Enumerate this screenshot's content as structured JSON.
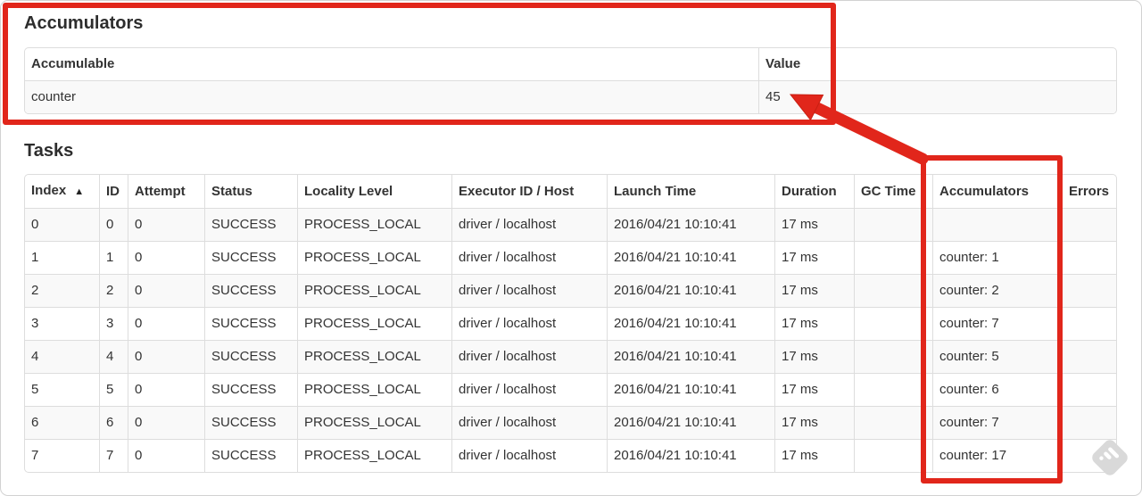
{
  "headings": {
    "accumulators": "Accumulators",
    "tasks": "Tasks"
  },
  "tables": {
    "accumulators": {
      "headers": [
        "Accumulable",
        "Value"
      ],
      "sorted_column": -1,
      "sort_icon": "",
      "rows": [
        [
          "counter",
          "45"
        ]
      ]
    },
    "tasks": {
      "headers": [
        "Index",
        "ID",
        "Attempt",
        "Status",
        "Locality Level",
        "Executor ID / Host",
        "Launch Time",
        "Duration",
        "GC Time",
        "Accumulators",
        "Errors"
      ],
      "sorted_column": 0,
      "sort_icon": "▲",
      "rows": [
        [
          "0",
          "0",
          "0",
          "SUCCESS",
          "PROCESS_LOCAL",
          "driver / localhost",
          "2016/04/21 10:10:41",
          "17 ms",
          "",
          "",
          ""
        ],
        [
          "1",
          "1",
          "0",
          "SUCCESS",
          "PROCESS_LOCAL",
          "driver / localhost",
          "2016/04/21 10:10:41",
          "17 ms",
          "",
          "counter: 1",
          ""
        ],
        [
          "2",
          "2",
          "0",
          "SUCCESS",
          "PROCESS_LOCAL",
          "driver / localhost",
          "2016/04/21 10:10:41",
          "17 ms",
          "",
          "counter: 2",
          ""
        ],
        [
          "3",
          "3",
          "0",
          "SUCCESS",
          "PROCESS_LOCAL",
          "driver / localhost",
          "2016/04/21 10:10:41",
          "17 ms",
          "",
          "counter: 7",
          ""
        ],
        [
          "4",
          "4",
          "0",
          "SUCCESS",
          "PROCESS_LOCAL",
          "driver / localhost",
          "2016/04/21 10:10:41",
          "17 ms",
          "",
          "counter: 5",
          ""
        ],
        [
          "5",
          "5",
          "0",
          "SUCCESS",
          "PROCESS_LOCAL",
          "driver / localhost",
          "2016/04/21 10:10:41",
          "17 ms",
          "",
          "counter: 6",
          ""
        ],
        [
          "6",
          "6",
          "0",
          "SUCCESS",
          "PROCESS_LOCAL",
          "driver / localhost",
          "2016/04/21 10:10:41",
          "17 ms",
          "",
          "counter: 7",
          ""
        ],
        [
          "7",
          "7",
          "0",
          "SUCCESS",
          "PROCESS_LOCAL",
          "driver / localhost",
          "2016/04/21 10:10:41",
          "17 ms",
          "",
          "counter: 17",
          ""
        ]
      ]
    }
  },
  "annotations": {
    "highlight_color": "#e1261b"
  },
  "icons": {
    "sort_ascending": "▲",
    "watermark": "skitch-stamp-icon"
  }
}
